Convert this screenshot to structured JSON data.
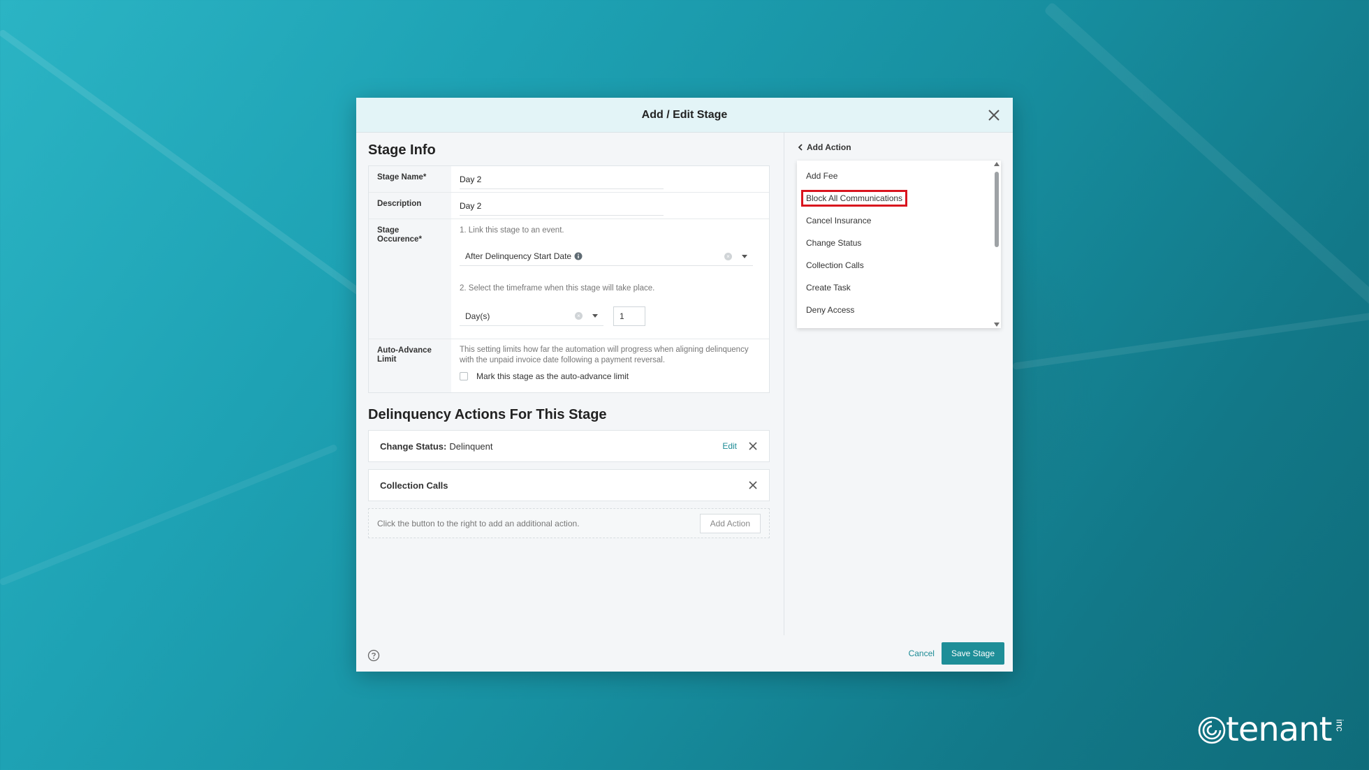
{
  "modal": {
    "title": "Add / Edit Stage"
  },
  "stage_info": {
    "title": "Stage Info",
    "fields": {
      "stage_name_label": "Stage Name*",
      "stage_name_value": "Day 2",
      "description_label": "Description",
      "description_value": "Day 2",
      "occurrence_label": "Stage Occurence*",
      "occurrence_hint1": "1. Link this stage to an event.",
      "occurrence_event": "After Delinquency Start Date",
      "occurrence_hint2": "2. Select the timeframe when this stage will take place.",
      "timeframe_unit": "Day(s)",
      "timeframe_value": "1",
      "auto_advance_label": "Auto-Advance Limit",
      "auto_advance_desc": "This setting limits how far the automation will progress when aligning delinquency with the unpaid invoice date following a payment reversal.",
      "auto_advance_checkbox": "Mark this stage as the auto-advance limit"
    }
  },
  "actions_section": {
    "title": "Delinquency Actions For This Stage",
    "actions": [
      {
        "name": "Change Status:",
        "detail": "Delinquent",
        "edit": "Edit"
      },
      {
        "name": "Collection Calls",
        "detail": "",
        "edit": ""
      }
    ],
    "add_hint": "Click the button to the right to add an additional action.",
    "add_button": "Add Action"
  },
  "add_action_panel": {
    "back_label": "Add Action",
    "items": [
      "Add Fee",
      "Block All Communications",
      "Cancel Insurance",
      "Change Status",
      "Collection Calls",
      "Create Task",
      "Deny Access"
    ],
    "highlighted_item": "Block All Communications"
  },
  "footer": {
    "cancel": "Cancel",
    "save": "Save Stage"
  },
  "branding": {
    "logo_text": "tenant",
    "logo_suffix": "inc"
  },
  "icons": {
    "close": "close-icon",
    "info": "info-icon",
    "help": "help-icon",
    "back": "chevron-left-icon"
  },
  "colors": {
    "accent": "#1e8e98",
    "highlight": "#d9141e",
    "header_bg": "#e3f4f7"
  }
}
